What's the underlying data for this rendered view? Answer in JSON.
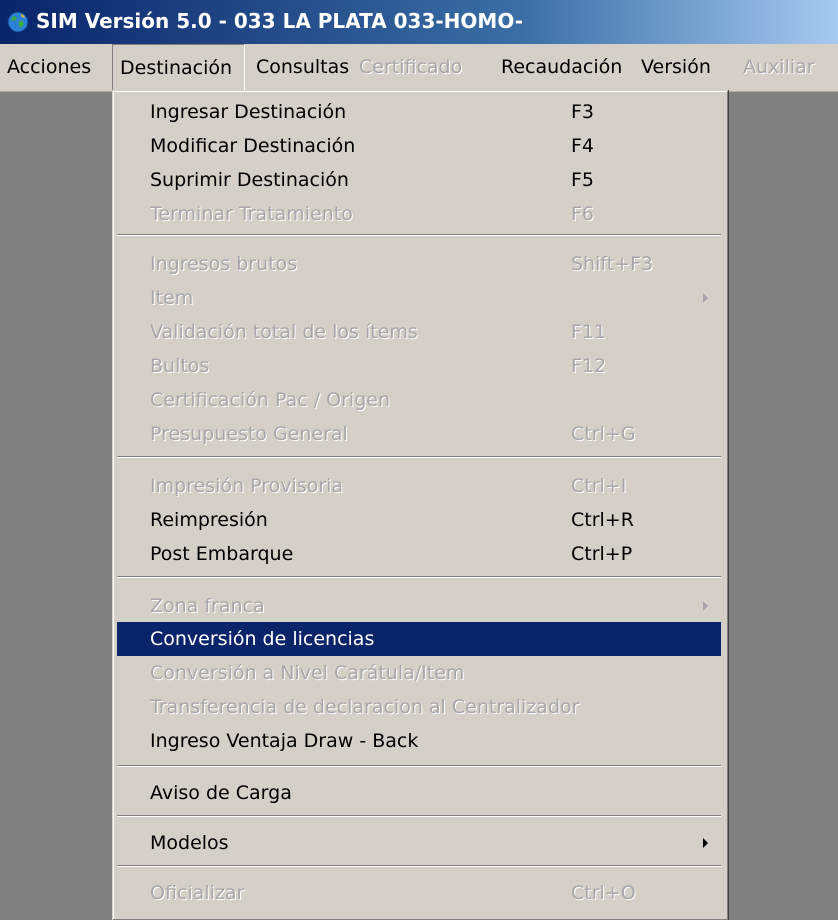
{
  "window": {
    "title": "SIM Versión 5.0 - 033 LA PLATA 033-HOMO-",
    "icon": "globe-icon"
  },
  "menubar": {
    "items": [
      {
        "label": "Acciones",
        "enabled": true
      },
      {
        "label": "Destinación",
        "enabled": true,
        "open": true
      },
      {
        "label": "Consultas",
        "enabled": true
      },
      {
        "label": "Certificado",
        "enabled": false
      },
      {
        "label": "Recaudación",
        "enabled": true
      },
      {
        "label": "Versión",
        "enabled": true
      },
      {
        "label": "Auxiliar",
        "enabled": false
      }
    ]
  },
  "menu": {
    "items": [
      {
        "label": "Ingresar Destinación",
        "shortcut": "F3",
        "enabled": true
      },
      {
        "label": "Modificar Destinación",
        "shortcut": "F4",
        "enabled": true
      },
      {
        "label": "Suprimir Destinación",
        "shortcut": "F5",
        "enabled": true
      },
      {
        "label": "Terminar Tratamiento",
        "shortcut": "F6",
        "enabled": false
      },
      {
        "label": "Ingresos brutos",
        "shortcut": "Shift+F3",
        "enabled": false
      },
      {
        "label": "Item",
        "shortcut": "",
        "enabled": false,
        "submenu": true
      },
      {
        "label": "Validación total de los ítems",
        "shortcut": "F11",
        "enabled": false
      },
      {
        "label": "Bultos",
        "shortcut": "F12",
        "enabled": false
      },
      {
        "label": "Certificación Pac / Origen",
        "shortcut": "",
        "enabled": false
      },
      {
        "label": "Presupuesto General",
        "shortcut": "Ctrl+G",
        "enabled": false
      },
      {
        "label": "Impresión Provisoria",
        "shortcut": "Ctrl+I",
        "enabled": false
      },
      {
        "label": "Reimpresión",
        "shortcut": "Ctrl+R",
        "enabled": true
      },
      {
        "label": "Post Embarque",
        "shortcut": "Ctrl+P",
        "enabled": true
      },
      {
        "label": "Zona franca",
        "shortcut": "",
        "enabled": false,
        "submenu": true
      },
      {
        "label": "Conversión de licencias",
        "shortcut": "",
        "enabled": true,
        "selected": true
      },
      {
        "label": "Conversión a Nivel Carátula/Item",
        "shortcut": "",
        "enabled": false
      },
      {
        "label": "Transferencia de declaracion al Centralizador",
        "shortcut": "",
        "enabled": false
      },
      {
        "label": "Ingreso Ventaja Draw - Back",
        "shortcut": "",
        "enabled": true
      },
      {
        "label": "Aviso de Carga",
        "shortcut": "",
        "enabled": true
      },
      {
        "label": "Modelos",
        "shortcut": "",
        "enabled": true,
        "submenu": true
      },
      {
        "label": "Oficializar",
        "shortcut": "Ctrl+O",
        "enabled": false
      }
    ]
  },
  "colors": {
    "selection": "#0a246a",
    "disabled_text": "#a7a6aa",
    "face": "#d4d0c8",
    "desktop": "#808080"
  }
}
